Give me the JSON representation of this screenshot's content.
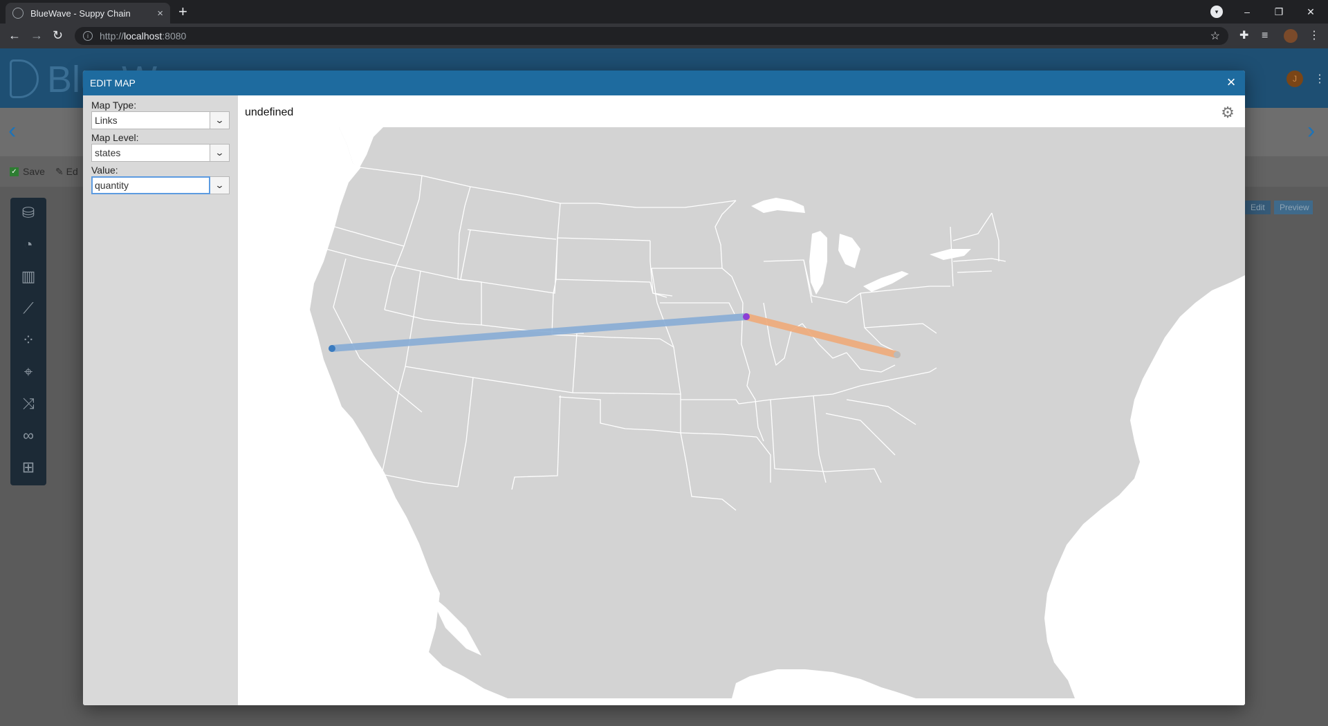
{
  "browser": {
    "tab_title": "BlueWave - Suppy Chain",
    "tab_close": "×",
    "new_tab": "+",
    "url_prefix": "http://",
    "url_host": "localhost",
    "url_port": ":8080",
    "window_controls": [
      "–",
      "❐",
      "✕"
    ]
  },
  "app": {
    "logo_text": "BlueW",
    "user_initial": "J",
    "save_label": "Save",
    "edit_label": "Ed",
    "mode_edit": "Edit",
    "mode_preview": "Preview"
  },
  "modal": {
    "title": "EDIT MAP",
    "close": "×",
    "map_title": "undefined",
    "fields": [
      {
        "label": "Map Type:",
        "value": "Links"
      },
      {
        "label": "Map Level:",
        "value": "states"
      },
      {
        "label": "Value:",
        "value": "quantity"
      }
    ]
  },
  "map": {
    "land_color": "#d3d3d3",
    "border_color": "#ffffff",
    "links": [
      {
        "color": "#8aaed6",
        "from": "California",
        "to": "Illinois"
      },
      {
        "color": "#efab7c",
        "from": "Illinois",
        "to": "Virginia"
      }
    ],
    "node_colors": {
      "start": "#3a7bbf",
      "hub": "#8b3fd6",
      "end": "#bbbbbb"
    }
  }
}
